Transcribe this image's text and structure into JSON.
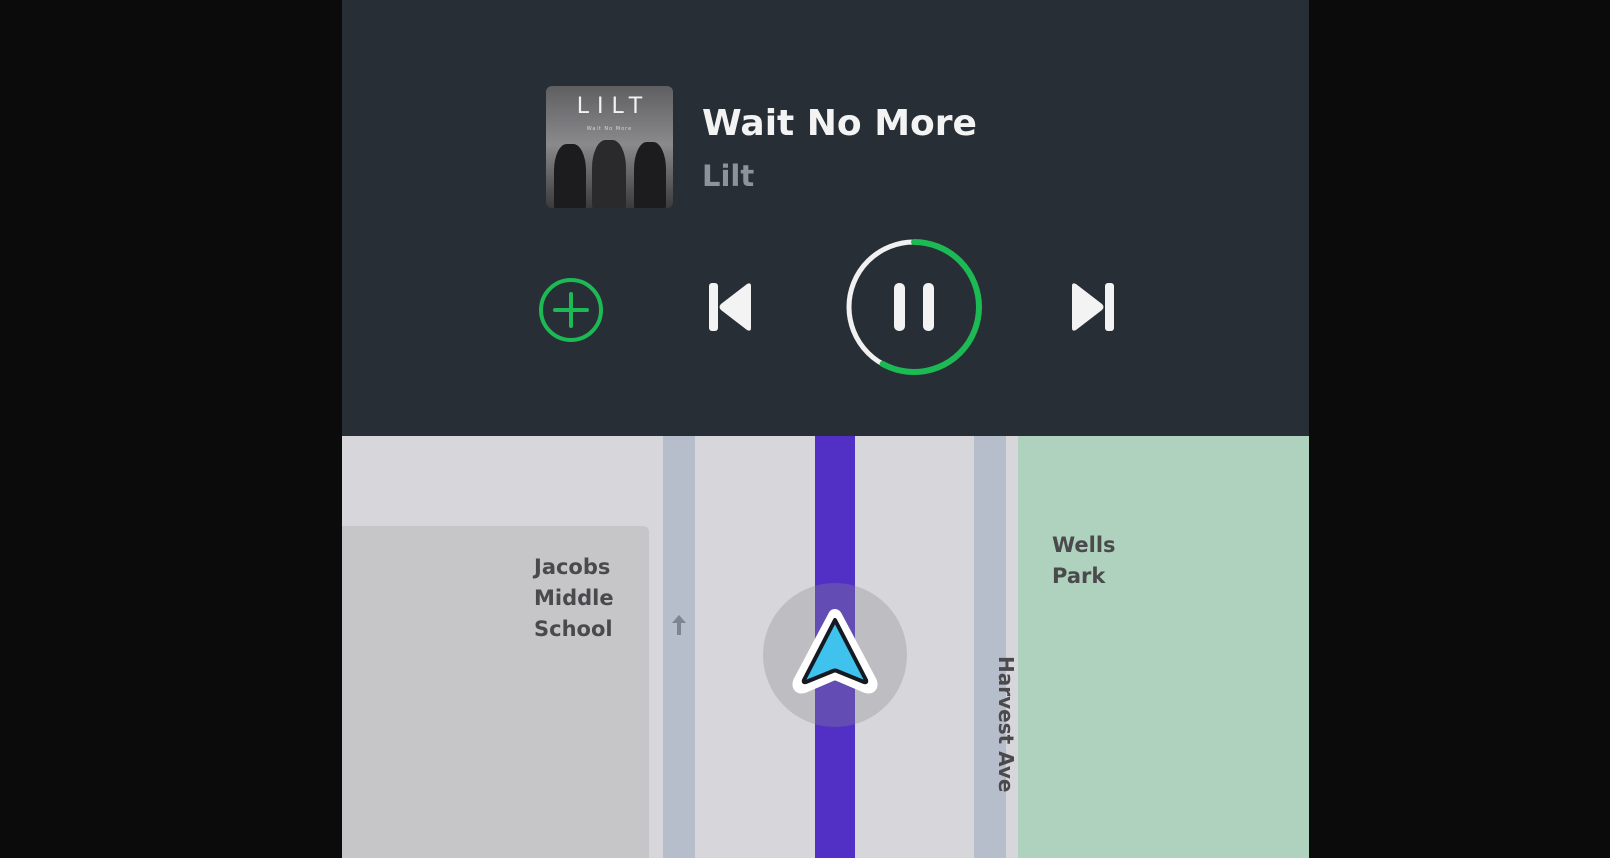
{
  "media": {
    "album_art_text": "LILT",
    "album_art_subtext": "Wait No More",
    "track_title": "Wait No More",
    "artist": "Lilt",
    "playback_progress": 0.58,
    "accent_color": "#1db954"
  },
  "controls": {
    "add": {
      "icon": "plus-circle-icon"
    },
    "previous": {
      "icon": "skip-previous-icon"
    },
    "play_pause": {
      "icon": "pause-icon",
      "state": "playing"
    },
    "next": {
      "icon": "skip-next-icon"
    }
  },
  "map": {
    "places": {
      "school": "Jacobs Middle School",
      "park": "Wells Park"
    },
    "street": "Harvest Ave",
    "route_color": "#5230c6",
    "park_color": "#aed2bd",
    "icons": {
      "one_way": "arrow-up-icon",
      "position": "navigation-arrow-icon"
    }
  }
}
